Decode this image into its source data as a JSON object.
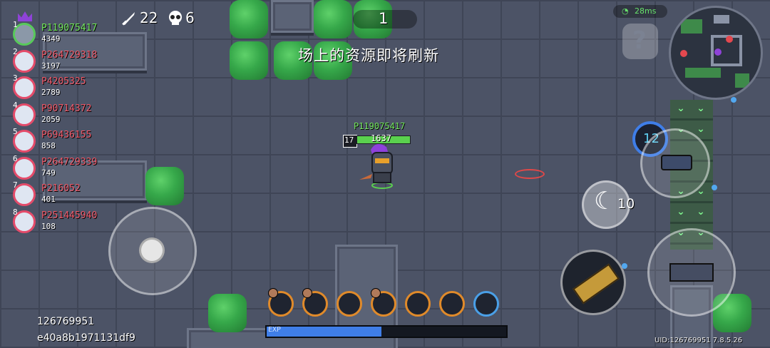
{
  "hud": {
    "kills": "22",
    "deaths": "6",
    "timer": "1",
    "announcement": "场上的资源即将刷新",
    "ping": "28ms",
    "help_glyph": "?",
    "skill_cooldown": "12",
    "secondary_ammo": "10",
    "exp_label": "EXP",
    "exp_progress": 0.48,
    "player_id": "126769951",
    "session_hash": "e40a8b1971131df9",
    "uid_version": "UID:126769951 7.8.5.26"
  },
  "player": {
    "name": "P119075417",
    "hp": "1637",
    "level": "17"
  },
  "leaderboard": [
    {
      "rank": "1",
      "name": "P119075417",
      "score": "4349",
      "me": true
    },
    {
      "rank": "2",
      "name": "P264729318",
      "score": "3197",
      "me": false
    },
    {
      "rank": "3",
      "name": "P4205325",
      "score": "2789",
      "me": false
    },
    {
      "rank": "4",
      "name": "P90714372",
      "score": "2059",
      "me": false
    },
    {
      "rank": "5",
      "name": "P69436155",
      "score": "858",
      "me": false
    },
    {
      "rank": "6",
      "name": "P264729339",
      "score": "749",
      "me": false
    },
    {
      "rank": "7",
      "name": "P216052",
      "score": "401",
      "me": false
    },
    {
      "rank": "8",
      "name": "P251445940",
      "score": "108",
      "me": false
    }
  ],
  "icons": {
    "sword": "sword-icon",
    "skull": "skull-icon",
    "wifi": "wifi-icon",
    "help": "help-icon"
  },
  "colors": {
    "self_name": "#74e85e",
    "enemy_name": "#f05a6a",
    "exp_bar": "#3f7ee8",
    "hp_bar": "#5ad14e"
  }
}
